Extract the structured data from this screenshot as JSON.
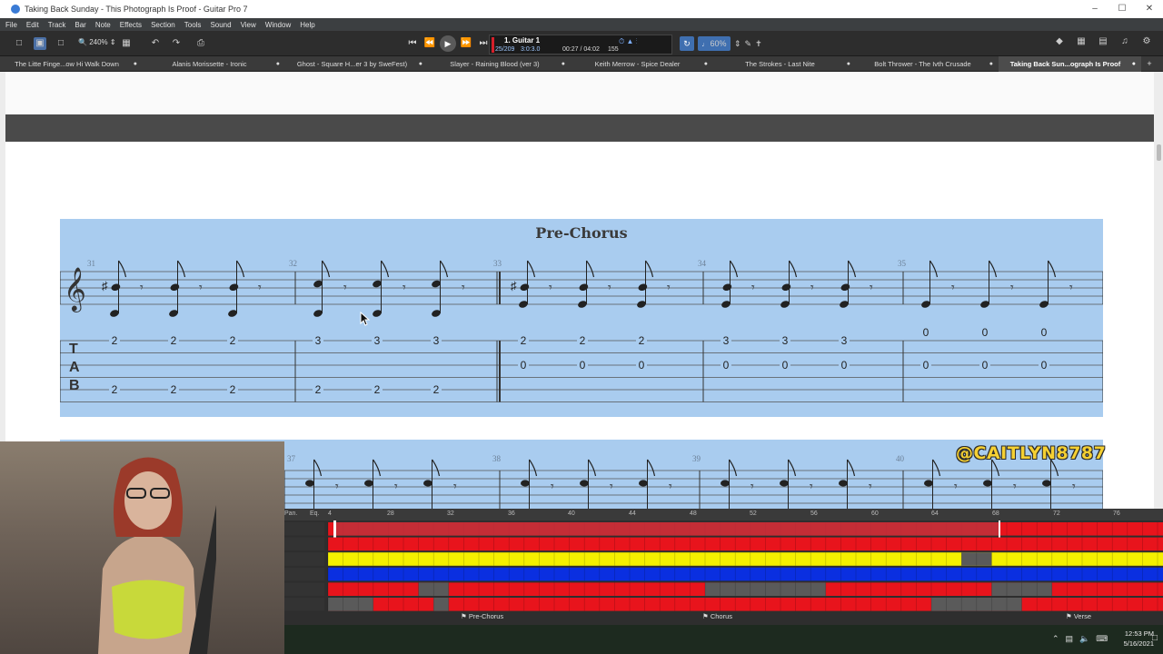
{
  "window": {
    "title": "Taking Back Sunday - This Photograph Is Proof - Guitar Pro 7",
    "controls": [
      "–",
      "☐",
      "✕"
    ]
  },
  "menu": [
    "File",
    "Edit",
    "Track",
    "Bar",
    "Note",
    "Effects",
    "Section",
    "Tools",
    "Sound",
    "View",
    "Window",
    "Help"
  ],
  "toolbar": {
    "zoom": "240%",
    "track_name": "1. Guitar 1",
    "bar_position": "25/209",
    "time_signature": "3:0:3.0",
    "time": "00:27 / 04:02",
    "tempo": "155",
    "speed": "60%"
  },
  "tabs": [
    {
      "label": "The Litte Finge...ow Hi Walk Down",
      "active": false
    },
    {
      "label": "Alanis Morissette - Ironic",
      "active": false
    },
    {
      "label": "Ghost - Square H...er 3 by SweFest)",
      "active": false
    },
    {
      "label": "Slayer - Raining Blood (ver 3)",
      "active": false
    },
    {
      "label": "Keith Merrow - Spice Dealer",
      "active": false
    },
    {
      "label": "The Strokes - Last Nite",
      "active": false
    },
    {
      "label": "Bolt Thrower - The Ivth Crusade",
      "active": false
    },
    {
      "label": "Taking Back Sun...ograph Is Proof",
      "active": true
    }
  ],
  "score": {
    "section_title": "Pre-Chorus",
    "system1_bars": [
      "31",
      "32",
      "33",
      "34",
      "35"
    ],
    "tab_letters": [
      "T",
      "A",
      "B"
    ],
    "tab_frets": [
      {
        "bar": 31,
        "top": [
          "2",
          "2",
          "2"
        ],
        "mid": [],
        "bottom": [
          "2",
          "2",
          "2"
        ]
      },
      {
        "bar": 32,
        "top": [
          "3",
          "3",
          "3"
        ],
        "mid": [],
        "bottom": [
          "2",
          "2",
          "2"
        ]
      },
      {
        "bar": 33,
        "top": [
          "2",
          "2",
          "2"
        ],
        "mid": [
          "0",
          "0",
          "0"
        ],
        "bottom": []
      },
      {
        "bar": 34,
        "top": [
          "3",
          "3",
          "3"
        ],
        "mid": [
          "0",
          "0",
          "0"
        ],
        "bottom": []
      },
      {
        "bar": 35,
        "top": [
          "0",
          "0",
          "0"
        ],
        "mid": [
          "0",
          "0",
          "0"
        ],
        "bottom": []
      }
    ],
    "system2_bars": [
      "37",
      "38",
      "39",
      "40"
    ]
  },
  "overlay_handle": "@CAITLYN8787",
  "tracks": {
    "header_labels": [
      "Pan.",
      "Eq."
    ],
    "ruler": [
      "4",
      "28",
      "32",
      "36",
      "40",
      "44",
      "48",
      "52",
      "56",
      "60",
      "64",
      "68",
      "72",
      "76"
    ],
    "markers": [
      "Pre-Chorus",
      "Chorus",
      "Verse"
    ],
    "colors": {
      "red": "#e8141c",
      "yellow": "#f5f000",
      "blue": "#0a2fe0",
      "gray": "#5a5a5a",
      "selection": "#c0303a"
    }
  },
  "clock": {
    "time": "12:53 PM",
    "date": "5/16/2021"
  }
}
